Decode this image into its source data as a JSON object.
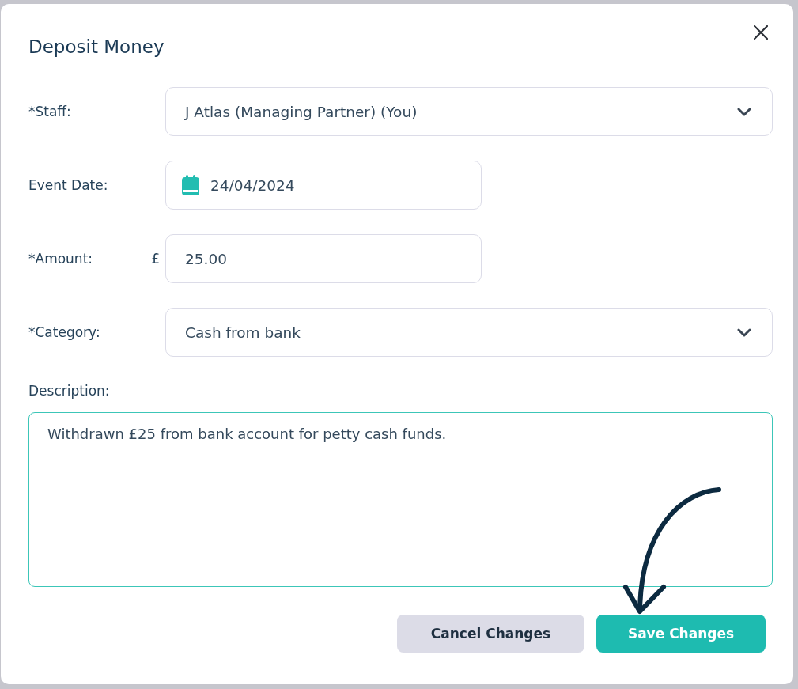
{
  "dialog": {
    "title": "Deposit Money"
  },
  "fields": [
    {
      "kind": "select",
      "label": "*Staff:",
      "value": "J Atlas (Managing Partner) (You)"
    },
    {
      "kind": "date",
      "label": "Event Date:",
      "value": "24/04/2024"
    },
    {
      "kind": "currency",
      "label": "*Amount:",
      "prefix": "£",
      "value": "25.00"
    },
    {
      "kind": "select",
      "label": "*Category:",
      "value": "Cash from bank"
    }
  ],
  "description": {
    "label": "Description:",
    "value": "Withdrawn £25 from bank account for petty cash funds.",
    "focused": true
  },
  "buttons": [
    {
      "kind": "secondary",
      "label": "Cancel Changes"
    },
    {
      "kind": "primary",
      "label": "Save Changes"
    }
  ]
}
